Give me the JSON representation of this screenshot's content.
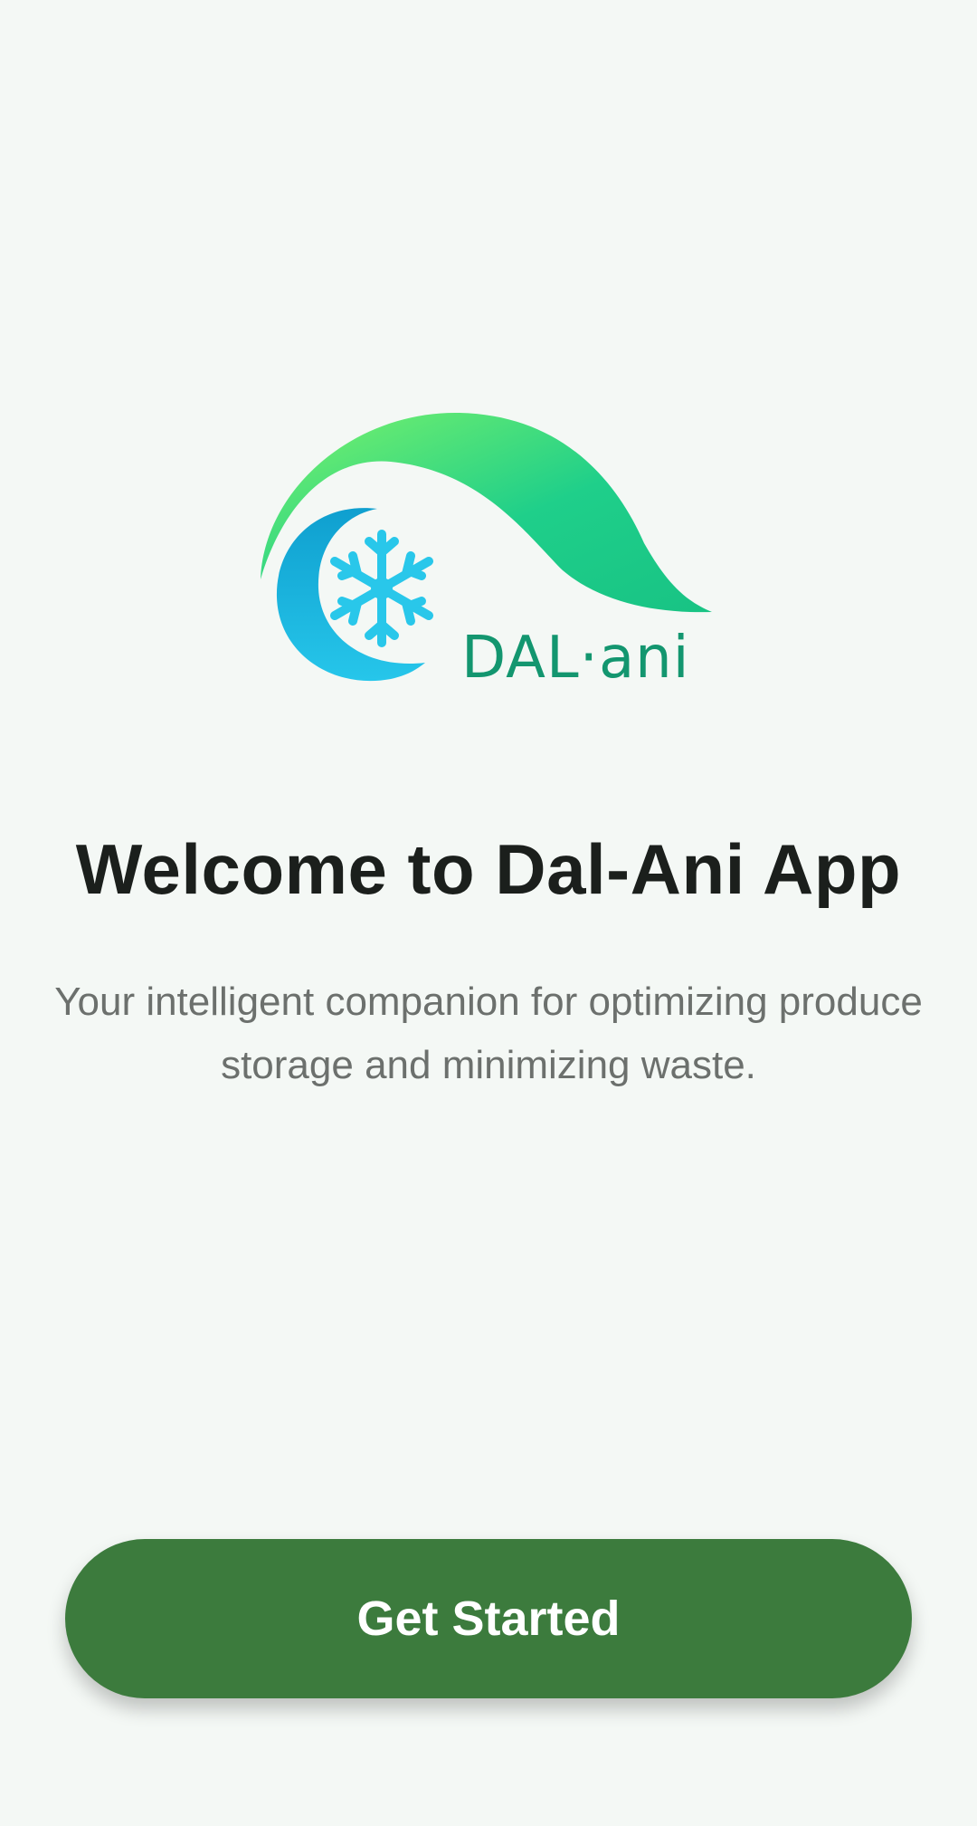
{
  "logo": {
    "icon": "dalani-logo-icon",
    "wordmark": "DAL·ani",
    "colors": {
      "leaf_light": "#6cf06a",
      "leaf_dark": "#19c38d",
      "crescent": "#12b3dc",
      "snowflake": "#29c7ea",
      "wordmark": "#13966f"
    }
  },
  "welcome": {
    "title": "Welcome to Dal-Ani App",
    "subtitle": "Your intelligent companion for optimizing produce storage and minimizing waste."
  },
  "actions": {
    "get_started_label": "Get Started",
    "color": "#3c7b3d"
  },
  "theme": {
    "background": "#f4f8f5"
  }
}
